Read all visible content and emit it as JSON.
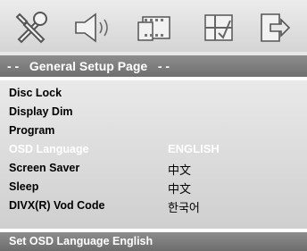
{
  "toolbar": {
    "icons": [
      "general-setup-icon",
      "audio-setup-icon",
      "video-setup-icon",
      "preference-icon",
      "exit-icon"
    ]
  },
  "page": {
    "title": "- -   General Setup Page   - -"
  },
  "menu": {
    "items": [
      {
        "label": "Disc Lock",
        "value": ""
      },
      {
        "label": "Display Dim",
        "value": ""
      },
      {
        "label": "Program",
        "value": ""
      },
      {
        "label": "OSD Language",
        "value": "ENGLISH"
      },
      {
        "label": "Screen Saver",
        "value": "中文"
      },
      {
        "label": "Sleep",
        "value": "中文"
      },
      {
        "label": "DIVX(R) Vod Code",
        "value": "한국어"
      }
    ],
    "selected_index": 3
  },
  "status": {
    "text": "Set OSD Language English"
  },
  "colors": {
    "selected_text": "#ffffff",
    "bar": "#7f7f7f"
  }
}
